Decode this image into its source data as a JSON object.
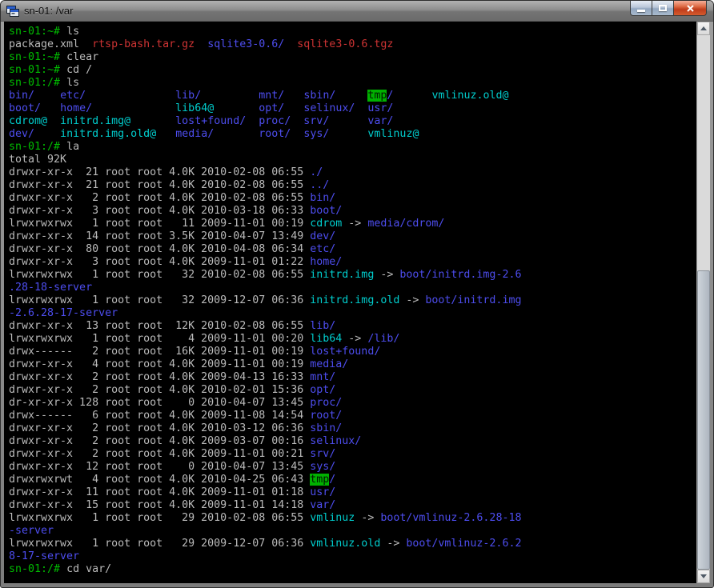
{
  "window": {
    "title": "sn-01: /var",
    "app_icon": "putty-terminal-icon",
    "buttons": {
      "minimize": "minimize",
      "maximize": "maximize",
      "close": "close"
    }
  },
  "colors": {
    "terminal_bg": "#000000",
    "prompt": "#00bb00",
    "fg": "#bbbbbb",
    "dir": "#4d4dee",
    "link": "#00cdcd",
    "archive": "#cd3333",
    "sticky_fg": "#001a00",
    "sticky_bg": "#00b000",
    "close_button": "#c03c1b",
    "titlebar": "#8d8d8d"
  },
  "scrollbar": {
    "up_icon": "up-arrow-icon",
    "down_icon": "down-arrow-icon",
    "thumb_position": "bottom"
  },
  "terminal": {
    "columns": 80,
    "lines": [
      [
        {
          "c": "prompt",
          "t": "sn-01:~# "
        },
        {
          "c": "fg",
          "t": "ls"
        }
      ],
      [
        {
          "c": "fg",
          "t": "package.xml  "
        },
        {
          "c": "archive",
          "t": "rtsp-bash.tar.gz"
        },
        {
          "c": "fg",
          "t": "  "
        },
        {
          "c": "dir",
          "t": "sqlite3-0.6/"
        },
        {
          "c": "fg",
          "t": "  "
        },
        {
          "c": "archive",
          "t": "sqlite3-0.6.tgz"
        }
      ],
      [
        {
          "c": "prompt",
          "t": "sn-01:~# "
        },
        {
          "c": "fg",
          "t": "clear"
        }
      ],
      [
        {
          "c": "prompt",
          "t": "sn-01:~# "
        },
        {
          "c": "fg",
          "t": "cd /"
        }
      ],
      [
        {
          "c": "prompt",
          "t": "sn-01:/# "
        },
        {
          "c": "fg",
          "t": "ls"
        }
      ],
      [
        {
          "c": "dir",
          "t": "bin/"
        },
        {
          "c": "fg",
          "t": "    "
        },
        {
          "c": "dir",
          "t": "etc/"
        },
        {
          "c": "fg",
          "t": "              "
        },
        {
          "c": "dir",
          "t": "lib/"
        },
        {
          "c": "fg",
          "t": "         "
        },
        {
          "c": "dir",
          "t": "mnt/"
        },
        {
          "c": "fg",
          "t": "   "
        },
        {
          "c": "dir",
          "t": "sbin/"
        },
        {
          "c": "fg",
          "t": "     "
        },
        {
          "c": "sticky",
          "t": "tmp"
        },
        {
          "c": "dir",
          "t": "/"
        },
        {
          "c": "fg",
          "t": "      "
        },
        {
          "c": "link",
          "t": "vmlinuz.old@"
        }
      ],
      [
        {
          "c": "dir",
          "t": "boot/"
        },
        {
          "c": "fg",
          "t": "   "
        },
        {
          "c": "dir",
          "t": "home/"
        },
        {
          "c": "fg",
          "t": "             "
        },
        {
          "c": "link",
          "t": "lib64@"
        },
        {
          "c": "fg",
          "t": "       "
        },
        {
          "c": "dir",
          "t": "opt/"
        },
        {
          "c": "fg",
          "t": "   "
        },
        {
          "c": "dir",
          "t": "selinux/"
        },
        {
          "c": "fg",
          "t": "  "
        },
        {
          "c": "dir",
          "t": "usr/"
        }
      ],
      [
        {
          "c": "link",
          "t": "cdrom@"
        },
        {
          "c": "fg",
          "t": "  "
        },
        {
          "c": "link",
          "t": "initrd.img@"
        },
        {
          "c": "fg",
          "t": "       "
        },
        {
          "c": "dir",
          "t": "lost+found/"
        },
        {
          "c": "fg",
          "t": "  "
        },
        {
          "c": "dir",
          "t": "proc/"
        },
        {
          "c": "fg",
          "t": "  "
        },
        {
          "c": "dir",
          "t": "srv/"
        },
        {
          "c": "fg",
          "t": "      "
        },
        {
          "c": "dir",
          "t": "var/"
        }
      ],
      [
        {
          "c": "dir",
          "t": "dev/"
        },
        {
          "c": "fg",
          "t": "    "
        },
        {
          "c": "link",
          "t": "initrd.img.old@"
        },
        {
          "c": "fg",
          "t": "   "
        },
        {
          "c": "dir",
          "t": "media/"
        },
        {
          "c": "fg",
          "t": "       "
        },
        {
          "c": "dir",
          "t": "root/"
        },
        {
          "c": "fg",
          "t": "  "
        },
        {
          "c": "dir",
          "t": "sys/"
        },
        {
          "c": "fg",
          "t": "      "
        },
        {
          "c": "link",
          "t": "vmlinuz@"
        }
      ],
      [
        {
          "c": "prompt",
          "t": "sn-01:/# "
        },
        {
          "c": "fg",
          "t": "la"
        }
      ],
      [
        {
          "c": "fg",
          "t": "total 92K"
        }
      ],
      [
        {
          "c": "fg",
          "t": "drwxr-xr-x  21 root root 4.0K 2010-02-08 06:55 "
        },
        {
          "c": "dir",
          "t": "./"
        }
      ],
      [
        {
          "c": "fg",
          "t": "drwxr-xr-x  21 root root 4.0K 2010-02-08 06:55 "
        },
        {
          "c": "dir",
          "t": "../"
        }
      ],
      [
        {
          "c": "fg",
          "t": "drwxr-xr-x   2 root root 4.0K 2010-02-08 06:55 "
        },
        {
          "c": "dir",
          "t": "bin/"
        }
      ],
      [
        {
          "c": "fg",
          "t": "drwxr-xr-x   3 root root 4.0K 2010-03-18 06:33 "
        },
        {
          "c": "dir",
          "t": "boot/"
        }
      ],
      [
        {
          "c": "fg",
          "t": "lrwxrwxrwx   1 root root   11 2009-11-01 00:19 "
        },
        {
          "c": "link",
          "t": "cdrom"
        },
        {
          "c": "fg",
          "t": " -> "
        },
        {
          "c": "dir",
          "t": "media/cdrom/"
        }
      ],
      [
        {
          "c": "fg",
          "t": "drwxr-xr-x  14 root root 3.5K 2010-04-07 13:49 "
        },
        {
          "c": "dir",
          "t": "dev/"
        }
      ],
      [
        {
          "c": "fg",
          "t": "drwxr-xr-x  80 root root 4.0K 2010-04-08 06:34 "
        },
        {
          "c": "dir",
          "t": "etc/"
        }
      ],
      [
        {
          "c": "fg",
          "t": "drwxr-xr-x   3 root root 4.0K 2009-11-01 01:22 "
        },
        {
          "c": "dir",
          "t": "home/"
        }
      ],
      [
        {
          "c": "fg",
          "t": "lrwxrwxrwx   1 root root   32 2010-02-08 06:55 "
        },
        {
          "c": "link",
          "t": "initrd.img"
        },
        {
          "c": "fg",
          "t": " -> "
        },
        {
          "c": "dir",
          "t": "boot/initrd.img-2.6"
        }
      ],
      [
        {
          "c": "dir",
          "t": ".28-18-server"
        }
      ],
      [
        {
          "c": "fg",
          "t": "lrwxrwxrwx   1 root root   32 2009-12-07 06:36 "
        },
        {
          "c": "link",
          "t": "initrd.img.old"
        },
        {
          "c": "fg",
          "t": " -> "
        },
        {
          "c": "dir",
          "t": "boot/initrd.img"
        }
      ],
      [
        {
          "c": "dir",
          "t": "-2.6.28-17-server"
        }
      ],
      [
        {
          "c": "fg",
          "t": "drwxr-xr-x  13 root root  12K 2010-02-08 06:55 "
        },
        {
          "c": "dir",
          "t": "lib/"
        }
      ],
      [
        {
          "c": "fg",
          "t": "lrwxrwxrwx   1 root root    4 2009-11-01 00:20 "
        },
        {
          "c": "link",
          "t": "lib64"
        },
        {
          "c": "fg",
          "t": " -> "
        },
        {
          "c": "dir",
          "t": "/lib/"
        }
      ],
      [
        {
          "c": "fg",
          "t": "drwx------   2 root root  16K 2009-11-01 00:19 "
        },
        {
          "c": "dir",
          "t": "lost+found/"
        }
      ],
      [
        {
          "c": "fg",
          "t": "drwxr-xr-x   4 root root 4.0K 2009-11-01 00:19 "
        },
        {
          "c": "dir",
          "t": "media/"
        }
      ],
      [
        {
          "c": "fg",
          "t": "drwxr-xr-x   2 root root 4.0K 2009-04-13 16:33 "
        },
        {
          "c": "dir",
          "t": "mnt/"
        }
      ],
      [
        {
          "c": "fg",
          "t": "drwxr-xr-x   2 root root 4.0K 2010-02-01 15:36 "
        },
        {
          "c": "dir",
          "t": "opt/"
        }
      ],
      [
        {
          "c": "fg",
          "t": "dr-xr-xr-x 128 root root    0 2010-04-07 13:45 "
        },
        {
          "c": "dir",
          "t": "proc/"
        }
      ],
      [
        {
          "c": "fg",
          "t": "drwx------   6 root root 4.0K 2009-11-08 14:54 "
        },
        {
          "c": "dir",
          "t": "root/"
        }
      ],
      [
        {
          "c": "fg",
          "t": "drwxr-xr-x   2 root root 4.0K 2010-03-12 06:36 "
        },
        {
          "c": "dir",
          "t": "sbin/"
        }
      ],
      [
        {
          "c": "fg",
          "t": "drwxr-xr-x   2 root root 4.0K 2009-03-07 00:16 "
        },
        {
          "c": "dir",
          "t": "selinux/"
        }
      ],
      [
        {
          "c": "fg",
          "t": "drwxr-xr-x   2 root root 4.0K 2009-11-01 00:21 "
        },
        {
          "c": "dir",
          "t": "srv/"
        }
      ],
      [
        {
          "c": "fg",
          "t": "drwxr-xr-x  12 root root    0 2010-04-07 13:45 "
        },
        {
          "c": "dir",
          "t": "sys/"
        }
      ],
      [
        {
          "c": "fg",
          "t": "drwxrwxrwt   4 root root 4.0K 2010-04-25 06:43 "
        },
        {
          "c": "sticky",
          "t": "tmp"
        },
        {
          "c": "dir",
          "t": "/"
        }
      ],
      [
        {
          "c": "fg",
          "t": "drwxr-xr-x  11 root root 4.0K 2009-11-01 01:18 "
        },
        {
          "c": "dir",
          "t": "usr/"
        }
      ],
      [
        {
          "c": "fg",
          "t": "drwxr-xr-x  15 root root 4.0K 2009-11-01 14:18 "
        },
        {
          "c": "dir",
          "t": "var/"
        }
      ],
      [
        {
          "c": "fg",
          "t": "lrwxrwxrwx   1 root root   29 2010-02-08 06:55 "
        },
        {
          "c": "link",
          "t": "vmlinuz"
        },
        {
          "c": "fg",
          "t": " -> "
        },
        {
          "c": "dir",
          "t": "boot/vmlinuz-2.6.28-18"
        }
      ],
      [
        {
          "c": "dir",
          "t": "-server"
        }
      ],
      [
        {
          "c": "fg",
          "t": "lrwxrwxrwx   1 root root   29 2009-12-07 06:36 "
        },
        {
          "c": "link",
          "t": "vmlinuz.old"
        },
        {
          "c": "fg",
          "t": " -> "
        },
        {
          "c": "dir",
          "t": "boot/vmlinuz-2.6.2"
        }
      ],
      [
        {
          "c": "dir",
          "t": "8-17-server"
        }
      ],
      [
        {
          "c": "prompt",
          "t": "sn-01:/# "
        },
        {
          "c": "fg",
          "t": "cd var/"
        }
      ]
    ]
  }
}
